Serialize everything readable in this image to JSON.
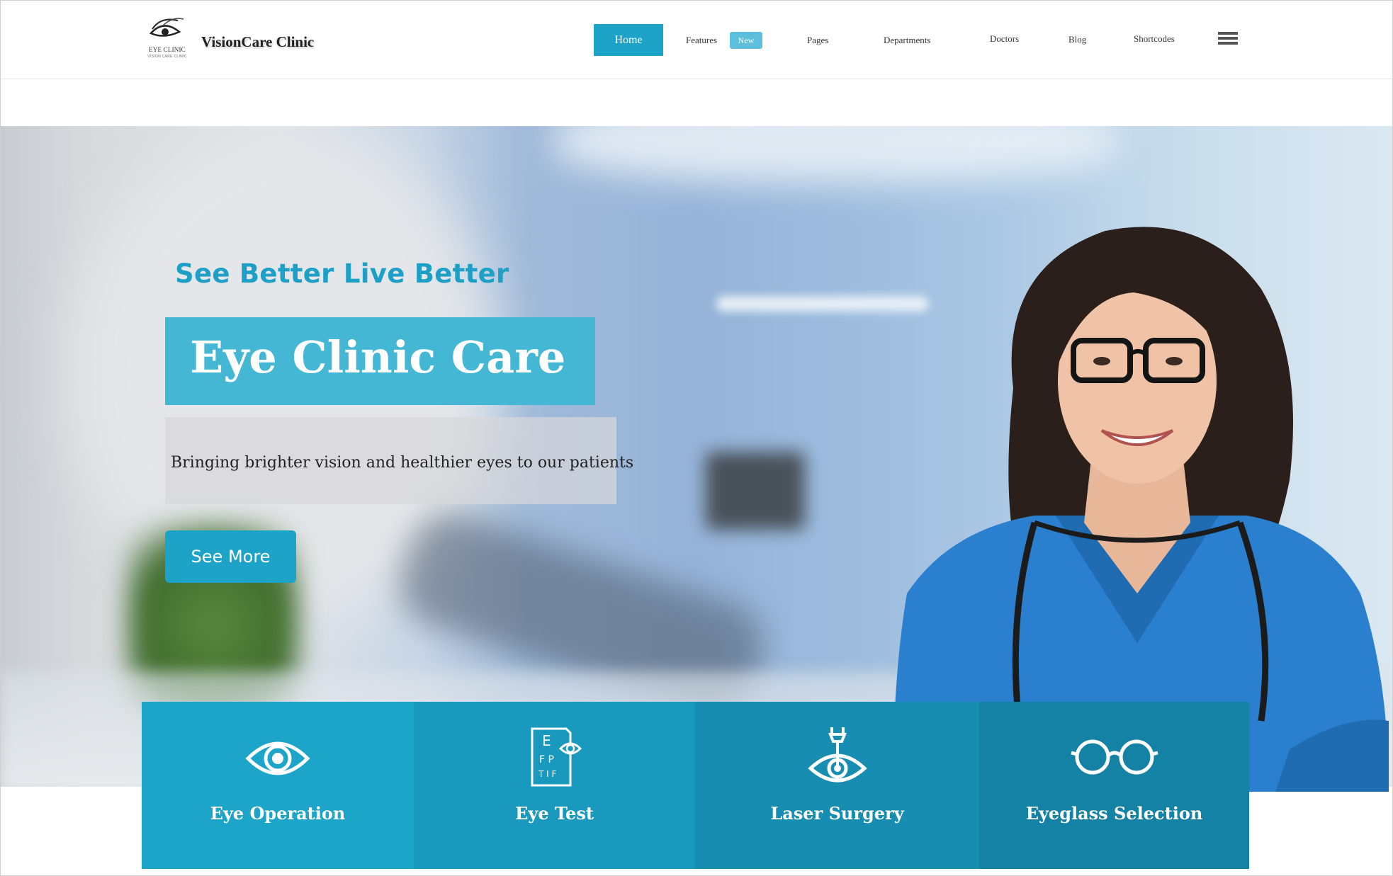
{
  "logo": {
    "line1": "EYE CLINIC",
    "line2": "VISION CARE CLINIC"
  },
  "brand": "VisionCare Clinic",
  "nav": {
    "home": "Home",
    "features": "Features",
    "features_badge": "New",
    "pages": "Pages",
    "departments": "Departments",
    "doctors": "Doctors",
    "blog": "Blog",
    "shortcodes": "Shortcodes"
  },
  "hero": {
    "tagline": "See Better Live Better",
    "title": "Eye Clinic Care",
    "subtitle": "Bringing brighter vision and healthier eyes to our patients",
    "cta": "See More"
  },
  "services": [
    {
      "label": "Eye Operation",
      "icon": "eye-icon",
      "color": "#1da4c9"
    },
    {
      "label": "Eye Test",
      "icon": "eye-chart-icon",
      "color": "#1999bd"
    },
    {
      "label": "Laser Surgery",
      "icon": "laser-eye-icon",
      "color": "#178eb1"
    },
    {
      "label": "Eyeglass Selection",
      "icon": "eyeglasses-icon",
      "color": "#1482a4"
    }
  ],
  "colors": {
    "accent": "#1ea3c8",
    "title_box": "#44b7d4",
    "badge": "#5cc0dc"
  }
}
